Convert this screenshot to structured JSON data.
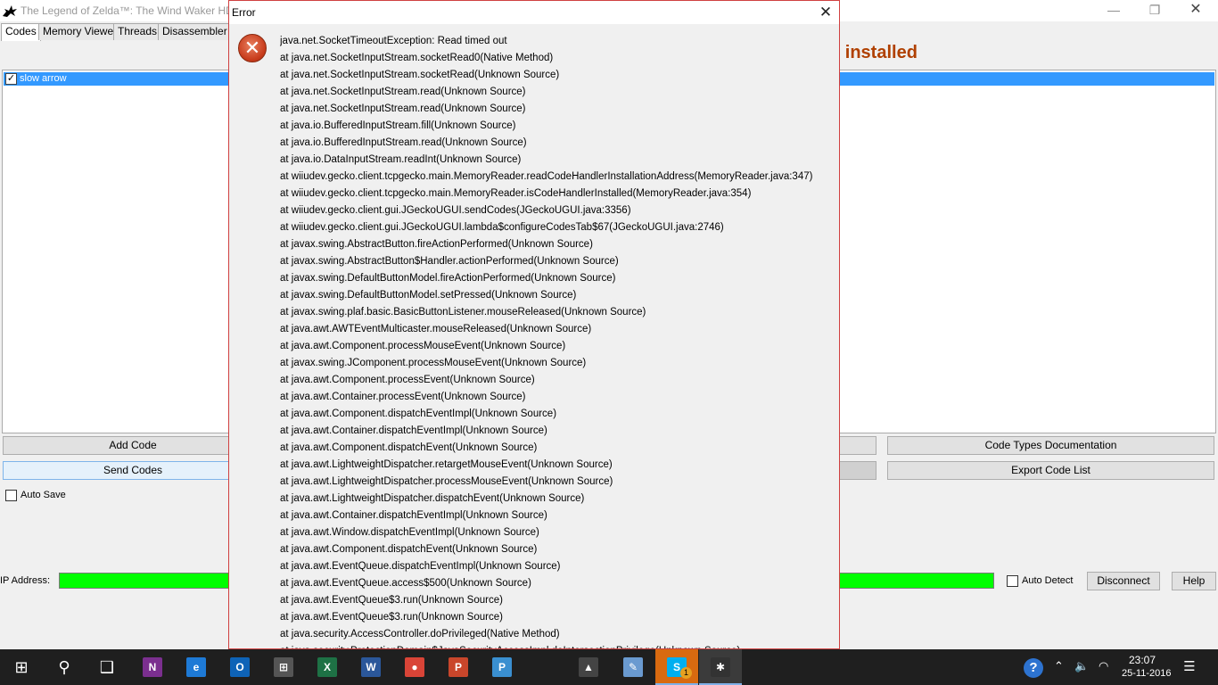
{
  "app": {
    "title": "The Legend of Zelda™: The Wind Waker HD",
    "minimize_glyph": "—",
    "maximize_glyph": "❐",
    "close_glyph": "✕",
    "tabs": [
      {
        "label": "Codes",
        "active": true
      },
      {
        "label": "Memory Viewer"
      },
      {
        "label": "Threads"
      },
      {
        "label": "Disassembler"
      }
    ],
    "status_partial": "n installed",
    "codes": [
      {
        "label": "slow arrow",
        "checked": true,
        "selected": true
      }
    ],
    "check_glyph": "✓",
    "buttons": {
      "add_code": "Add Code",
      "send_codes": "Send Codes",
      "code_types_doc": "Code Types Documentation",
      "export_code_list": "Export Code List",
      "disconnect": "Disconnect",
      "help": "Help"
    },
    "auto_save_label": "Auto Save",
    "ip_address_label": "IP Address:",
    "auto_detect_label": "Auto Detect",
    "colors": {
      "connected": "#00ff00",
      "status": "#b04000",
      "selection": "#3399ff"
    }
  },
  "dialog": {
    "title": "Error",
    "close_glyph": "✕",
    "icon": "error-icon",
    "icon_glyph": "✕",
    "trace": [
      "java.net.SocketTimeoutException: Read timed out",
      "at java.net.SocketInputStream.socketRead0(Native Method)",
      "at java.net.SocketInputStream.socketRead(Unknown Source)",
      "at java.net.SocketInputStream.read(Unknown Source)",
      "at java.net.SocketInputStream.read(Unknown Source)",
      "at java.io.BufferedInputStream.fill(Unknown Source)",
      "at java.io.BufferedInputStream.read(Unknown Source)",
      "at java.io.DataInputStream.readInt(Unknown Source)",
      "at wiiudev.gecko.client.tcpgecko.main.MemoryReader.readCodeHandlerInstallationAddress(MemoryReader.java:347)",
      "at wiiudev.gecko.client.tcpgecko.main.MemoryReader.isCodeHandlerInstalled(MemoryReader.java:354)",
      "at wiiudev.gecko.client.gui.JGeckoUGUI.sendCodes(JGeckoUGUI.java:3356)",
      "at wiiudev.gecko.client.gui.JGeckoUGUI.lambda$configureCodesTab$67(JGeckoUGUI.java:2746)",
      "at javax.swing.AbstractButton.fireActionPerformed(Unknown Source)",
      "at javax.swing.AbstractButton$Handler.actionPerformed(Unknown Source)",
      "at javax.swing.DefaultButtonModel.fireActionPerformed(Unknown Source)",
      "at javax.swing.DefaultButtonModel.setPressed(Unknown Source)",
      "at javax.swing.plaf.basic.BasicButtonListener.mouseReleased(Unknown Source)",
      "at java.awt.AWTEventMulticaster.mouseReleased(Unknown Source)",
      "at java.awt.Component.processMouseEvent(Unknown Source)",
      "at javax.swing.JComponent.processMouseEvent(Unknown Source)",
      "at java.awt.Component.processEvent(Unknown Source)",
      "at java.awt.Container.processEvent(Unknown Source)",
      "at java.awt.Component.dispatchEventImpl(Unknown Source)",
      "at java.awt.Container.dispatchEventImpl(Unknown Source)",
      "at java.awt.Component.dispatchEvent(Unknown Source)",
      "at java.awt.LightweightDispatcher.retargetMouseEvent(Unknown Source)",
      "at java.awt.LightweightDispatcher.processMouseEvent(Unknown Source)",
      "at java.awt.LightweightDispatcher.dispatchEvent(Unknown Source)",
      "at java.awt.Container.dispatchEventImpl(Unknown Source)",
      "at java.awt.Window.dispatchEventImpl(Unknown Source)",
      "at java.awt.Component.dispatchEvent(Unknown Source)",
      "at java.awt.EventQueue.dispatchEventImpl(Unknown Source)",
      "at java.awt.EventQueue.access$500(Unknown Source)",
      "at java.awt.EventQueue$3.run(Unknown Source)",
      "at java.awt.EventQueue$3.run(Unknown Source)",
      "at java.security.AccessController.doPrivileged(Native Method)",
      "at java.security.ProtectionDomain$JavaSecurityAccessImpl.doIntersectionPrivilege(Unknown Source)"
    ]
  },
  "taskbar": {
    "items": [
      {
        "name": "start-icon",
        "glyph": "⊞",
        "color": "transparent"
      },
      {
        "name": "search-icon",
        "glyph": "⚲",
        "color": "transparent"
      },
      {
        "name": "task-view-icon",
        "glyph": "❑",
        "color": "transparent"
      },
      {
        "name": "onenote-icon",
        "glyph": "N",
        "color": "#7b2f8f"
      },
      {
        "name": "edge-icon",
        "glyph": "e",
        "color": "#1e7ad6"
      },
      {
        "name": "outlook-icon",
        "glyph": "O",
        "color": "#0e63b7"
      },
      {
        "name": "store-icon",
        "glyph": "⊞",
        "color": "#555555"
      },
      {
        "name": "excel-icon",
        "glyph": "X",
        "color": "#1e7145"
      },
      {
        "name": "word-icon",
        "glyph": "W",
        "color": "#2b579a"
      },
      {
        "name": "chrome-icon",
        "glyph": "●",
        "color": "#d94437"
      },
      {
        "name": "powerpoint-icon",
        "glyph": "P",
        "color": "#c9462b"
      },
      {
        "name": "app-p-icon",
        "glyph": "P",
        "color": "#3a8fd0"
      },
      {
        "name": "photos-icon",
        "glyph": "▲",
        "color": "#444444"
      },
      {
        "name": "paint-icon",
        "glyph": "✎",
        "color": "#6a9ad0"
      },
      {
        "name": "skype-icon",
        "glyph": "S",
        "color": "#00aff0",
        "badge": "1",
        "active": true
      },
      {
        "name": "jgecko-icon",
        "glyph": "✱",
        "color": "#333333",
        "active": true
      }
    ],
    "tray": {
      "help_glyph": "?",
      "up_glyph": "⌃",
      "vol_glyph": "🔈",
      "wifi_glyph": "◠",
      "notify_glyph": "☰"
    },
    "time": "23:07",
    "date": "25-11-2016"
  }
}
